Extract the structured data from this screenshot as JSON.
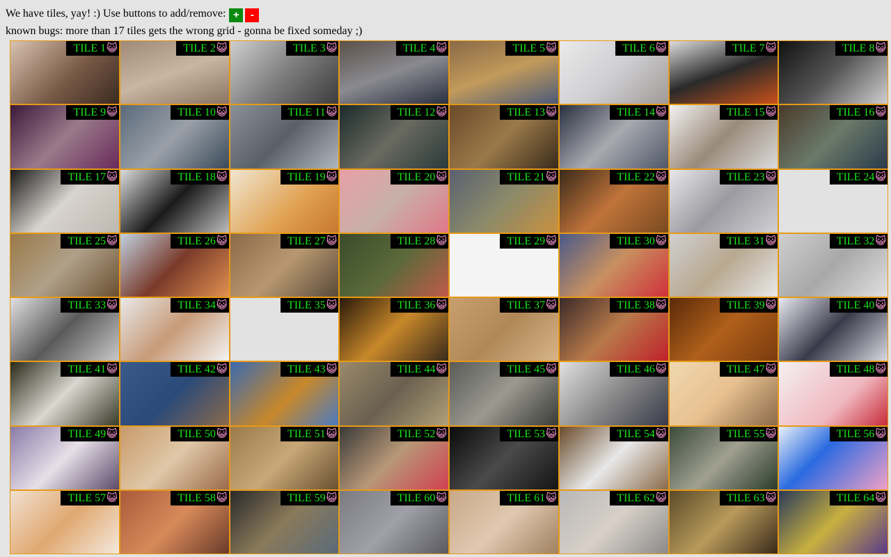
{
  "header": {
    "intro_text": "We have tiles, yay! :) Use buttons to add/remove:",
    "add_label": "+",
    "remove_label": "-",
    "bugs_text": "known bugs: more than 17 tiles gets the wrong grid - gonna be fixed someday ;)"
  },
  "colors": {
    "add_button": "#0b8a10",
    "remove_button": "#ff0000",
    "tile_border": "#e79a16",
    "label_text": "#19e619",
    "label_bg": "#000000",
    "cat_face": "#ff9ad6"
  },
  "tile_icon": "cat-face-icon",
  "tiles": [
    {
      "label": "TILE 1",
      "bg": "linear-gradient(135deg,#d8c2b0,#7a5a48 55%,#3a2a20)"
    },
    {
      "label": "TILE 2",
      "bg": "linear-gradient(160deg,#a08a78,#c9b6a2 50%,#8a7462)"
    },
    {
      "label": "TILE 3",
      "bg": "linear-gradient(135deg,#cfcfcf,#7e7e7e 50%,#3c3c3c)"
    },
    {
      "label": "TILE 4",
      "bg": "linear-gradient(160deg,#5a5048,#8a8a90 50%,#2a3040)"
    },
    {
      "label": "TILE 5",
      "bg": "linear-gradient(160deg,#8a6a48,#c29a5a 50%,#4a5a7a)"
    },
    {
      "label": "TILE 6",
      "bg": "linear-gradient(135deg,#eaeaea,#cfcfd2 50%,#a09a98)"
    },
    {
      "label": "TILE 7",
      "bg": "linear-gradient(160deg,#dcdcdc,#2a2a2a 50%,#c8501a)"
    },
    {
      "label": "TILE 8",
      "bg": "linear-gradient(135deg,#111,#555 50%,#cfcfcf)"
    },
    {
      "label": "TILE 9",
      "bg": "linear-gradient(135deg,#3a1a3a,#9a7a8a 50%,#6a2a5a)"
    },
    {
      "label": "TILE 10",
      "bg": "linear-gradient(135deg,#5a6a7a,#9aa0a8 50%,#3a4a5a)"
    },
    {
      "label": "TILE 11",
      "bg": "linear-gradient(135deg,#8a9098,#5a6068 50%,#b0b6be)"
    },
    {
      "label": "TILE 12",
      "bg": "linear-gradient(135deg,#1a2a2a,#6a6a60 50%,#2a3a3a)"
    },
    {
      "label": "TILE 13",
      "bg": "linear-gradient(135deg,#6a4a2a,#9a7a4a 50%,#3a2a1a)"
    },
    {
      "label": "TILE 14",
      "bg": "linear-gradient(135deg,#2a3040,#a8aab0 50%,#505868)"
    },
    {
      "label": "TILE 15",
      "bg": "linear-gradient(135deg,#f2f2f2,#9a8a7a 50%,#dcdcdc)"
    },
    {
      "label": "TILE 16",
      "bg": "linear-gradient(135deg,#4a3a2a,#6a7a6a 50%,#2a3a4a)"
    },
    {
      "label": "TILE 17",
      "bg": "linear-gradient(135deg,#1a1a1a,#d8d4ce 50%,#bdb8b0)"
    },
    {
      "label": "TILE 18",
      "bg": "linear-gradient(135deg,#dcdcdc,#1a1a1a 50%,#bcbcbc)"
    },
    {
      "label": "TILE 19",
      "bg": "linear-gradient(135deg,#f0e6d0,#e0a050 60%,#c87830)"
    },
    {
      "label": "TILE 20",
      "bg": "linear-gradient(135deg,#e8a0a8,#c8b0a8 50%,#e07888)"
    },
    {
      "label": "TILE 21",
      "bg": "linear-gradient(135deg,#5a6070,#8a8a6a 50%,#c89040)"
    },
    {
      "label": "TILE 22",
      "bg": "linear-gradient(135deg,#3a2a1a,#c0743a 50%,#7a4a20)"
    },
    {
      "label": "TILE 23",
      "bg": "linear-gradient(135deg,#e8e8ea,#9a9aa0 50%,#d0d0d4)"
    },
    {
      "label": "TILE 24",
      "bg": "#e2e2e2"
    },
    {
      "label": "TILE 25",
      "bg": "linear-gradient(135deg,#9a7a48,#b0a08a 50%,#6a5030)"
    },
    {
      "label": "TILE 26",
      "bg": "linear-gradient(135deg,#c0d0e0,#7a3a2a 50%,#e09050)"
    },
    {
      "label": "TILE 27",
      "bg": "linear-gradient(135deg,#8a6a48,#b89870 50%,#5a4a3a)"
    },
    {
      "label": "TILE 28",
      "bg": "linear-gradient(135deg,#3a4a2a,#5a6a3a 50%,#c05a4a)"
    },
    {
      "label": "TILE 29",
      "bg": "#f4f4f4"
    },
    {
      "label": "TILE 30",
      "bg": "linear-gradient(135deg,#4a5a8a,#c89060 50%,#d0303a)"
    },
    {
      "label": "TILE 31",
      "bg": "linear-gradient(135deg,#d0d0d0,#b8a890 50%,#e8e8e8)"
    },
    {
      "label": "TILE 32",
      "bg": "linear-gradient(135deg,#cfcfcf,#a8a8a8 50%,#e0e0e0)"
    },
    {
      "label": "TILE 33",
      "bg": "linear-gradient(135deg,#e0e0e0,#5a5a5a 50%,#c8c8c8)"
    },
    {
      "label": "TILE 34",
      "bg": "linear-gradient(135deg,#e8e8e8,#c89a78 50%,#f4f4f4)"
    },
    {
      "label": "TILE 35",
      "bg": "#e2e2e2"
    },
    {
      "label": "TILE 36",
      "bg": "linear-gradient(135deg,#2a1a0a,#c8882a 50%,#3a2a1a)"
    },
    {
      "label": "TILE 37",
      "bg": "linear-gradient(135deg,#c8a070,#b08858 50%,#d8b488)"
    },
    {
      "label": "TILE 38",
      "bg": "linear-gradient(135deg,#3a2a2a,#b87a4a 50%,#c0202a)"
    },
    {
      "label": "TILE 39",
      "bg": "linear-gradient(135deg,#5a2a0a,#b0601a 50%,#7a3a10)"
    },
    {
      "label": "TILE 40",
      "bg": "linear-gradient(135deg,#e8e8f0,#3a3a4a 50%,#d8d8e0)"
    },
    {
      "label": "TILE 41",
      "bg": "linear-gradient(135deg,#2a2a1a,#d8d8d0 50%,#3a3a2a)"
    },
    {
      "label": "TILE 42",
      "bg": "linear-gradient(135deg,#3a5a8a,#2a4a7a 50%,#8a6a4a)"
    },
    {
      "label": "TILE 43",
      "bg": "linear-gradient(135deg,#3a6ab0,#c8882a 55%,#4a7ac0)"
    },
    {
      "label": "TILE 44",
      "bg": "linear-gradient(135deg,#9a8a6a,#6a6050 50%,#b0a078)"
    },
    {
      "label": "TILE 45",
      "bg": "linear-gradient(135deg,#5a5a58,#9a9a90 50%,#3a3a38)"
    },
    {
      "label": "TILE 46",
      "bg": "linear-gradient(135deg,#e0e0e0,#8a8a8a 50%,#3a3a4a)"
    },
    {
      "label": "TILE 47",
      "bg": "linear-gradient(135deg,#f0d8b0,#e8c090 50%,#8a6a4a)"
    },
    {
      "label": "TILE 48",
      "bg": "linear-gradient(135deg,#f4f0f0,#f0b8c0 60%,#c82a3a)"
    },
    {
      "label": "TILE 49",
      "bg": "linear-gradient(135deg,#8a7aa8,#e8e0e8 50%,#5a4a6a)"
    },
    {
      "label": "TILE 50",
      "bg": "linear-gradient(135deg,#c89a6a,#e0c8a8 50%,#9a6a4a)"
    },
    {
      "label": "TILE 51",
      "bg": "linear-gradient(135deg,#9a7a48,#c8a878 50%,#6a5030)"
    },
    {
      "label": "TILE 52",
      "bg": "linear-gradient(135deg,#3a3a38,#b89878 50%,#d04050)"
    },
    {
      "label": "TILE 53",
      "bg": "linear-gradient(135deg,#0a0a0a,#4a4a4a 50%,#141414)"
    },
    {
      "label": "TILE 54",
      "bg": "linear-gradient(135deg,#6a4a2a,#e8e8e8 50%,#8a6a4a)"
    },
    {
      "label": "TILE 55",
      "bg": "linear-gradient(135deg,#3a4a3a,#a0a090 50%,#2a3a2a)"
    },
    {
      "label": "TILE 56",
      "bg": "linear-gradient(135deg,#e8f0f8,#2a6ae0 40%,#f0a0c8)"
    },
    {
      "label": "TILE 57",
      "bg": "linear-gradient(135deg,#f0e0d0,#e0a870 50%,#f4e8dc)"
    },
    {
      "label": "TILE 58",
      "bg": "linear-gradient(135deg,#a85a3a,#d88a5a 50%,#6a3a2a)"
    },
    {
      "label": "TILE 59",
      "bg": "linear-gradient(135deg,#2a2a2a,#8a7a5a 50%,#5a6a7a)"
    },
    {
      "label": "TILE 60",
      "bg": "linear-gradient(135deg,#7a7a80,#a0a0a8 50%,#5a5a60)"
    },
    {
      "label": "TILE 61",
      "bg": "linear-gradient(135deg,#c8a888,#e0c8b0 50%,#a08060)"
    },
    {
      "label": "TILE 62",
      "bg": "linear-gradient(135deg,#b8b8b8,#d8d0c8 50%,#8a8a8a)"
    },
    {
      "label": "TILE 63",
      "bg": "linear-gradient(135deg,#5a4a2a,#b89a5a 50%,#3a2a1a)"
    },
    {
      "label": "TILE 64",
      "bg": "linear-gradient(135deg,#2a3a5a,#c8b040 50%,#5a3a8a)"
    }
  ]
}
